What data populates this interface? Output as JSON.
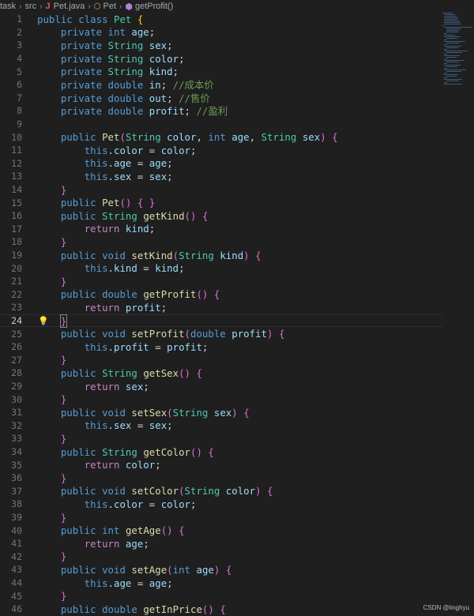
{
  "breadcrumb": {
    "items": [
      "task",
      "src",
      "Pet.java",
      "Pet",
      "getProfit()"
    ],
    "file_icon": "J"
  },
  "editor": {
    "current_line": 24,
    "lines": [
      {
        "n": "1",
        "t": "public class Pet {"
      },
      {
        "n": "2",
        "t": "    private int age;"
      },
      {
        "n": "3",
        "t": "    private String sex;"
      },
      {
        "n": "4",
        "t": "    private String color;"
      },
      {
        "n": "5",
        "t": "    private String kind;"
      },
      {
        "n": "6",
        "t": "    private double in; //成本价"
      },
      {
        "n": "7",
        "t": "    private double out; //售价"
      },
      {
        "n": "8",
        "t": "    private double profit; //盈利"
      },
      {
        "n": "9",
        "t": ""
      },
      {
        "n": "10",
        "t": "    public Pet(String color, int age, String sex) {"
      },
      {
        "n": "11",
        "t": "        this.color = color;"
      },
      {
        "n": "12",
        "t": "        this.age = age;"
      },
      {
        "n": "13",
        "t": "        this.sex = sex;"
      },
      {
        "n": "14",
        "t": "    }"
      },
      {
        "n": "15",
        "t": "    public Pet() { }"
      },
      {
        "n": "16",
        "t": "    public String getKind() {"
      },
      {
        "n": "17",
        "t": "        return kind;"
      },
      {
        "n": "18",
        "t": "    }"
      },
      {
        "n": "19",
        "t": "    public void setKind(String kind) {"
      },
      {
        "n": "20",
        "t": "        this.kind = kind;"
      },
      {
        "n": "21",
        "t": "    }"
      },
      {
        "n": "22",
        "t": "    public double getProfit() {"
      },
      {
        "n": "23",
        "t": "        return profit;"
      },
      {
        "n": "24",
        "t": "    }"
      },
      {
        "n": "25",
        "t": "    public void setProfit(double profit) {"
      },
      {
        "n": "26",
        "t": "        this.profit = profit;"
      },
      {
        "n": "27",
        "t": "    }"
      },
      {
        "n": "28",
        "t": "    public String getSex() {"
      },
      {
        "n": "29",
        "t": "        return sex;"
      },
      {
        "n": "30",
        "t": "    }"
      },
      {
        "n": "31",
        "t": "    public void setSex(String sex) {"
      },
      {
        "n": "32",
        "t": "        this.sex = sex;"
      },
      {
        "n": "33",
        "t": "    }"
      },
      {
        "n": "34",
        "t": "    public String getColor() {"
      },
      {
        "n": "35",
        "t": "        return color;"
      },
      {
        "n": "36",
        "t": "    }"
      },
      {
        "n": "37",
        "t": "    public void setColor(String color) {"
      },
      {
        "n": "38",
        "t": "        this.color = color;"
      },
      {
        "n": "39",
        "t": "    }"
      },
      {
        "n": "40",
        "t": "    public int getAge() {"
      },
      {
        "n": "41",
        "t": "        return age;"
      },
      {
        "n": "42",
        "t": "    }"
      },
      {
        "n": "43",
        "t": "    public void setAge(int age) {"
      },
      {
        "n": "44",
        "t": "        this.age = age;"
      },
      {
        "n": "45",
        "t": "    }"
      },
      {
        "n": "46",
        "t": "    public double getInPrice() {"
      }
    ]
  },
  "watermark": "CSDN @linghyu"
}
